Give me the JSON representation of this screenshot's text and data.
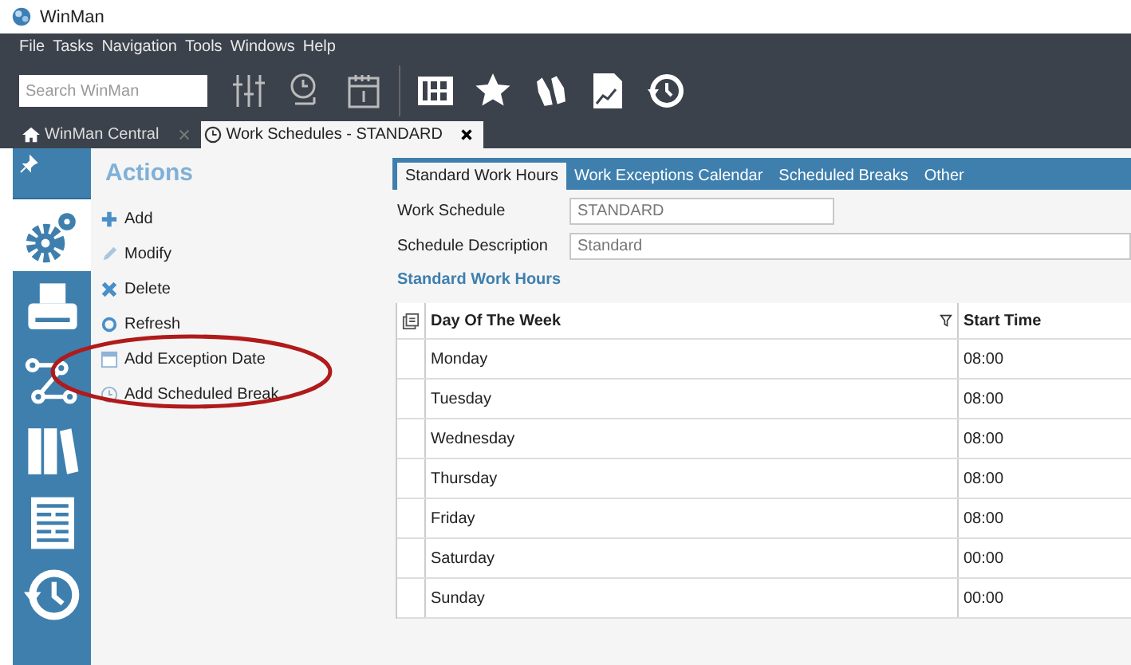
{
  "window": {
    "title": "WinMan"
  },
  "menu": [
    "File",
    "Tasks",
    "Navigation",
    "Tools",
    "Windows",
    "Help"
  ],
  "search": {
    "placeholder": "Search WinMan"
  },
  "toolbar": [
    {
      "kind": "sliders"
    },
    {
      "kind": "alarm"
    },
    {
      "kind": "calendar"
    },
    {
      "kind": "grid"
    },
    {
      "kind": "star"
    },
    {
      "kind": "hands"
    },
    {
      "kind": "report"
    },
    {
      "kind": "history"
    }
  ],
  "doc_tabs": [
    {
      "label": "WinMan Central",
      "kind": "home",
      "selected": false
    },
    {
      "label": "Work Schedules - STANDARD",
      "kind": "clock",
      "selected": true
    }
  ],
  "sidebar": {
    "items": [
      {
        "kind": "pin",
        "selected": false
      },
      {
        "kind": "gears",
        "selected": true
      },
      {
        "kind": "printer",
        "selected": false
      },
      {
        "kind": "network",
        "selected": false
      },
      {
        "kind": "binders",
        "selected": false
      },
      {
        "kind": "form",
        "selected": false
      },
      {
        "kind": "history",
        "selected": false
      }
    ]
  },
  "actions": {
    "title": "Actions",
    "items": [
      {
        "label": "Add",
        "kind": "add"
      },
      {
        "label": "Modify",
        "kind": "modify"
      },
      {
        "label": "Delete",
        "kind": "delete"
      },
      {
        "label": "Refresh",
        "kind": "refresh"
      },
      {
        "label": "Add Exception Date",
        "kind": "calendar"
      },
      {
        "label": "Add Scheduled Break",
        "kind": "clock"
      }
    ]
  },
  "tabs": [
    {
      "label": "Standard Work Hours",
      "selected": true
    },
    {
      "label": "Work Exceptions Calendar",
      "selected": false
    },
    {
      "label": "Scheduled Breaks",
      "selected": false
    },
    {
      "label": "Other",
      "selected": false
    }
  ],
  "form": [
    {
      "label": "Work Schedule",
      "value": "STANDARD",
      "wide": false
    },
    {
      "label": "Schedule Description",
      "value": "Standard",
      "wide": true
    }
  ],
  "section_title": "Standard Work Hours",
  "table": {
    "columns": [
      "Day Of The Week",
      "Start Time"
    ],
    "rows": [
      [
        "Monday",
        "08:00"
      ],
      [
        "Tuesday",
        "08:00"
      ],
      [
        "Wednesday",
        "08:00"
      ],
      [
        "Thursday",
        "08:00"
      ],
      [
        "Friday",
        "08:00"
      ],
      [
        "Saturday",
        "00:00"
      ],
      [
        "Sunday",
        "00:00"
      ]
    ]
  }
}
